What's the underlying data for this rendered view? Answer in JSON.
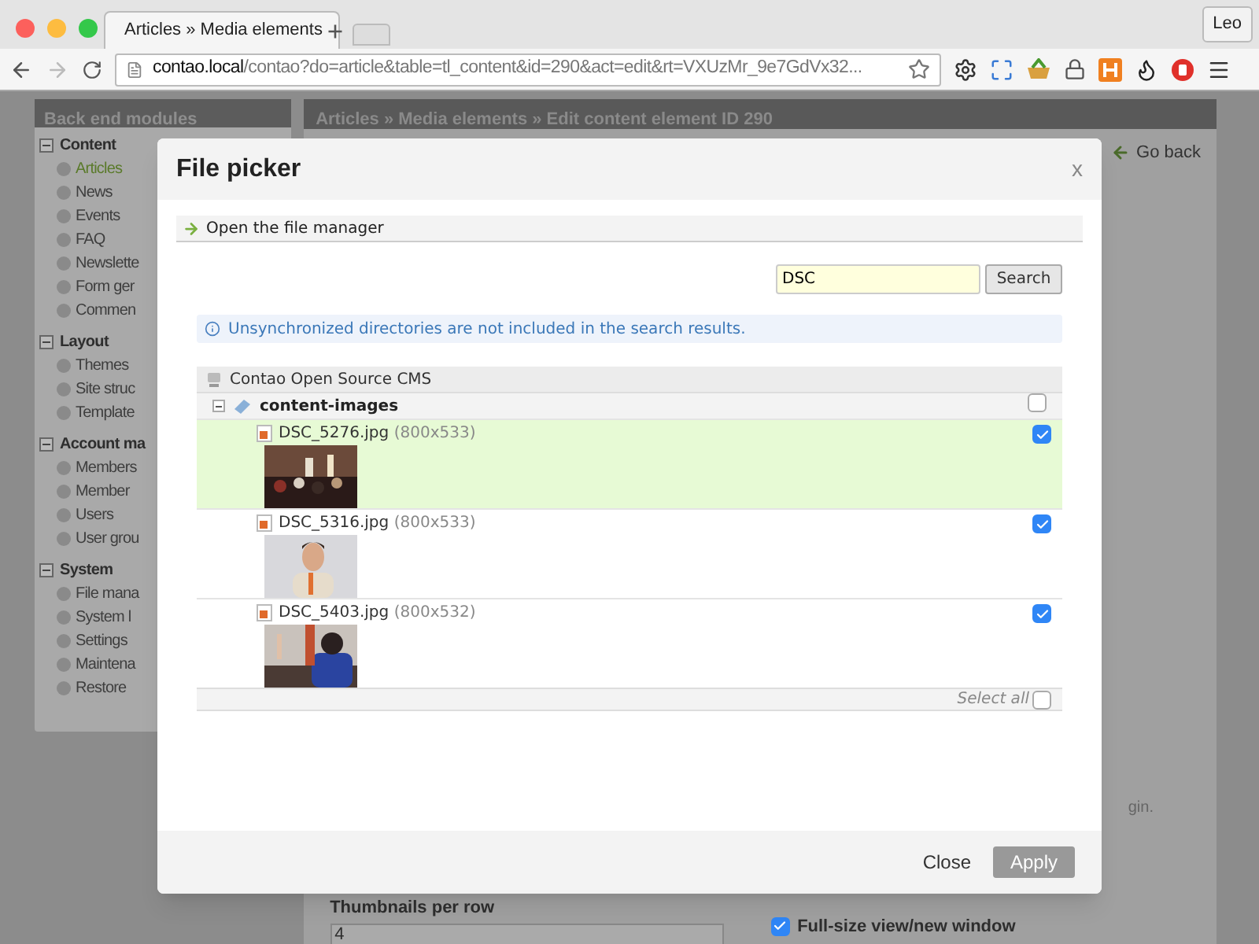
{
  "browser": {
    "tab_title": "Articles » Media elements",
    "user": "Leo",
    "url_host": "contao.local",
    "url_path": "/contao?do=article&table=tl_content&id=290&act=edit&rt=VXUzMr_9e7GdVx32..."
  },
  "sidebar": {
    "title": "Back end modules",
    "groups": [
      {
        "label": "Content",
        "expanded": true,
        "items": [
          {
            "label": "Articles",
            "selected": true
          },
          {
            "label": "News",
            "selected": false
          },
          {
            "label": "Events",
            "selected": false
          },
          {
            "label": "FAQ",
            "selected": false
          },
          {
            "label": "Newslette",
            "selected": false
          },
          {
            "label": "Form ger",
            "selected": false
          },
          {
            "label": "Commen",
            "selected": false
          }
        ]
      },
      {
        "label": "Layout",
        "expanded": true,
        "items": [
          {
            "label": "Themes",
            "selected": false
          },
          {
            "label": "Site struc",
            "selected": false
          },
          {
            "label": "Template",
            "selected": false
          }
        ]
      },
      {
        "label": "Account ma",
        "expanded": true,
        "items": [
          {
            "label": "Members",
            "selected": false
          },
          {
            "label": "Member",
            "selected": false
          },
          {
            "label": "Users",
            "selected": false
          },
          {
            "label": "User grou",
            "selected": false
          }
        ]
      },
      {
        "label": "System",
        "expanded": true,
        "items": [
          {
            "label": "File mana",
            "selected": false
          },
          {
            "label": "System l",
            "selected": false
          },
          {
            "label": "Settings",
            "selected": false
          },
          {
            "label": "Maintena",
            "selected": false
          },
          {
            "label": "Restore",
            "selected": false
          }
        ]
      }
    ]
  },
  "main": {
    "breadcrumb": "Articles » Media elements » Edit content element ID 290",
    "go_back": "Go back",
    "hint": "gin.",
    "thumbnails_label": "Thumbnails per row",
    "thumbnails_value": "4",
    "fullsize": {
      "label": "Full-size view/new window",
      "checked": true
    }
  },
  "dialog": {
    "title": "File picker",
    "close_x": "x",
    "file_manager_link": "Open the file manager",
    "search": {
      "value": "DSC",
      "button": "Search"
    },
    "info": "Unsynchronized directories are not included in the search results.",
    "tree": {
      "root": "Contao Open Source CMS",
      "folder": {
        "name": "content-images",
        "expanded": true,
        "checked": false,
        "files": [
          {
            "name": "DSC_5276.jpg",
            "size": "(800x533)",
            "checked": true,
            "selected": true
          },
          {
            "name": "DSC_5316.jpg",
            "size": "(800x533)",
            "checked": true,
            "selected": false
          },
          {
            "name": "DSC_5403.jpg",
            "size": "(800x532)",
            "checked": true,
            "selected": false
          }
        ]
      }
    },
    "select_all": {
      "label": "Select all",
      "checked": false
    },
    "buttons": {
      "close": "Close",
      "apply": "Apply"
    }
  }
}
